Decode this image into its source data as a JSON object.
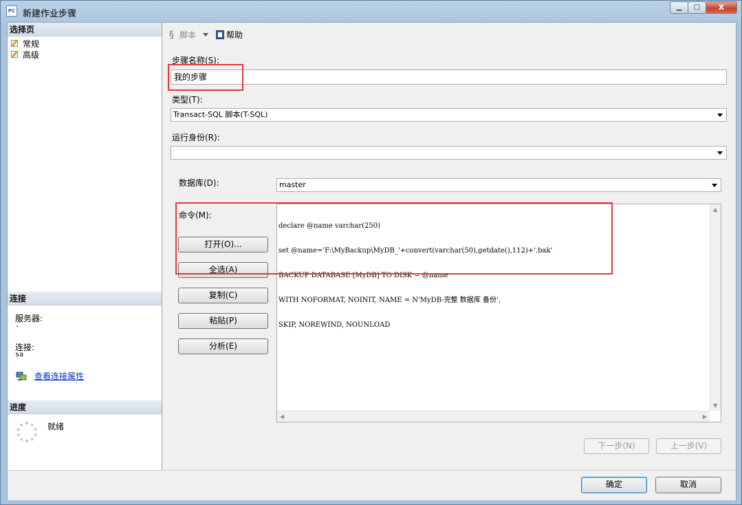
{
  "window": {
    "title": "新建作业步骤",
    "app_icon_label": "PC",
    "minimize_icon": "minimize-icon",
    "maximize_icon": "maximize-icon",
    "close_glyph": "x"
  },
  "left": {
    "select_page_header": "选择页",
    "pages": [
      {
        "label": "常规",
        "icon": "page-pencil-icon"
      },
      {
        "label": "高级",
        "icon": "page-pencil-icon"
      }
    ],
    "connection_header": "连接",
    "server_label": "服务器:",
    "server_value": ".",
    "connection_label": "连接:",
    "connection_value": "sa",
    "view_connection_link": "查看连接属性",
    "progress_header": "进度",
    "progress_status": "就绪"
  },
  "toolbar": {
    "script_label": "脚本",
    "help_label": "帮助"
  },
  "form": {
    "step_name_label": "步骤名称(S):",
    "step_name_value": "我的步骤",
    "type_label": "类型(T):",
    "type_value": "Transact-SQL 脚本(T-SQL)",
    "run_as_label": "运行身份(R):",
    "run_as_value": "",
    "database_label": "数据库(D):",
    "database_value": "master",
    "command_label": "命令(M):",
    "buttons": {
      "open": "打开(O)...",
      "select_all": "全选(A)",
      "copy": "复制(C)",
      "paste": "粘贴(P)",
      "parse": "分析(E)"
    },
    "command_lines": [
      "declare @name varchar(250)",
      "set @name='F:\\MyBackup\\MyDB_'+convert(varchar(50),getdate(),112)+'.bak'",
      "BACKUP DATABASE [MyDB] TO DISK = @name",
      "WITH NOFORMAT, NOINIT, NAME = N'MyDB-完整 数据库 备份',",
      "SKIP, NOREWIND, NOUNLOAD"
    ]
  },
  "nav": {
    "next": "下一步(N)",
    "previous": "上一步(V)"
  },
  "footer": {
    "ok": "确定",
    "cancel": "取消"
  },
  "colors": {
    "highlight_box": "#e0393e",
    "link": "#0033cc"
  }
}
